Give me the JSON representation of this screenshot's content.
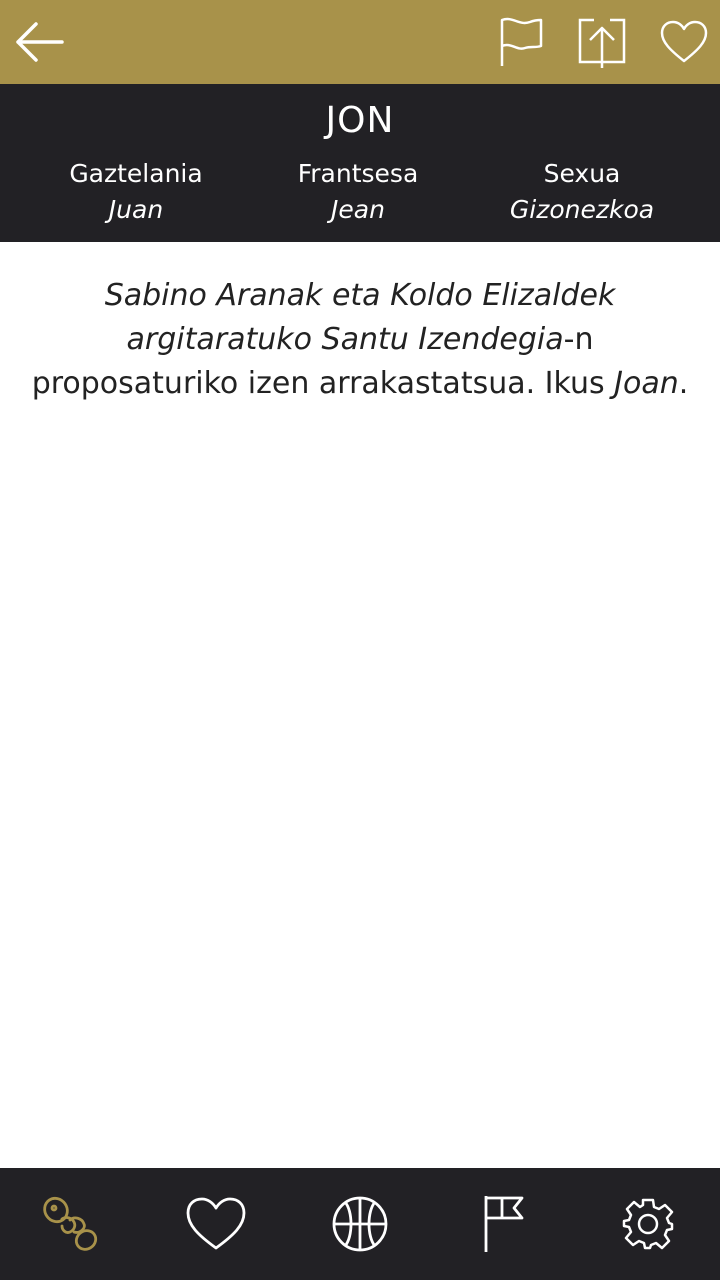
{
  "topbar": {
    "background": "#a8924a",
    "icons": [
      "arrow-left-icon",
      "flag-icon",
      "share-upload-icon",
      "heart-icon"
    ]
  },
  "header": {
    "name": "JON",
    "columns": [
      {
        "label": "Gaztelania",
        "value": "Juan"
      },
      {
        "label": "Frantsesa",
        "value": "Jean"
      },
      {
        "label": "Sexua",
        "value": "Gizonezkoa"
      }
    ]
  },
  "description": {
    "part1_italic": "Sabino Aranak eta Koldo Elizaldek argitaratuko Santu Izendegia",
    "part2": "-n proposaturiko izen arrakastatsua. Ikus ",
    "part3_italic": "Joan",
    "part4": "."
  },
  "bottomnav": {
    "items": [
      {
        "icon": "pacifier-icon",
        "active": true
      },
      {
        "icon": "heart-icon",
        "active": false
      },
      {
        "icon": "basketball-icon",
        "active": false
      },
      {
        "icon": "flag-icon",
        "active": false
      },
      {
        "icon": "gear-icon",
        "active": false
      }
    ],
    "active_color": "#a8924a",
    "inactive_color": "#ffffff"
  }
}
